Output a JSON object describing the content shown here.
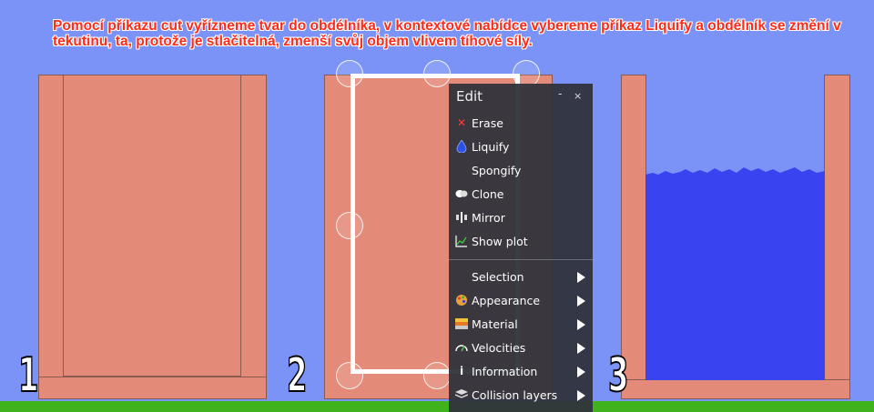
{
  "caption": "Pomocí příkazu cut vyřízneme tvar do obdélníka, v kontextové nabídce vybereme příkaz Liquify a obdélník se změní v tekutinu, ta, protože je stlačitelná, zmenší svůj objem vlivem tíhové síly.",
  "steps": [
    "1",
    "2",
    "3"
  ],
  "colors": {
    "background": "#7b93f6",
    "container": "#e48a78",
    "liquid": "#3a43f0",
    "ground": "#3fb21e",
    "menu": "#30323a",
    "caption": "#ff2a1a"
  },
  "menu": {
    "title": "Edit",
    "minimize": "-",
    "close": "×",
    "items": [
      {
        "label": "Erase",
        "icon": "erase-icon"
      },
      {
        "label": "Liquify",
        "icon": "liquify-icon"
      },
      {
        "label": "Spongify",
        "icon": ""
      },
      {
        "label": "Clone",
        "icon": "clone-icon"
      },
      {
        "label": "Mirror",
        "icon": "mirror-icon"
      },
      {
        "label": "Show plot",
        "icon": "plot-icon"
      }
    ],
    "submenus": [
      {
        "label": "Selection",
        "icon": ""
      },
      {
        "label": "Appearance",
        "icon": "appearance-icon"
      },
      {
        "label": "Material",
        "icon": "material-icon"
      },
      {
        "label": "Velocities",
        "icon": "velocities-icon"
      },
      {
        "label": "Information",
        "icon": "information-icon"
      },
      {
        "label": "Collision layers",
        "icon": "collision-layers-icon"
      }
    ]
  }
}
